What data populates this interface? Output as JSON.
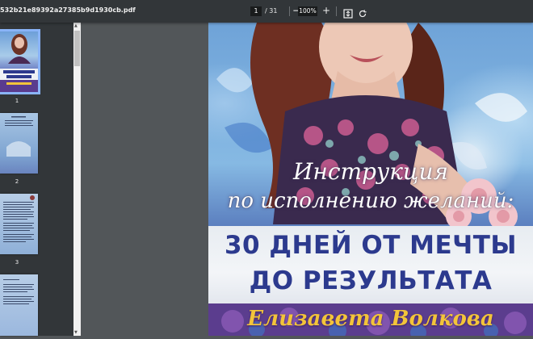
{
  "toolbar": {
    "filename": "532b21e89392a27385b9d1930cb.pdf",
    "current_page": "1",
    "page_separator": "/ 31",
    "zoom": "100%",
    "zoom_out_label": "−",
    "zoom_in_label": "+",
    "fit_icon": "fit-to-page-icon",
    "rotate_icon": "rotate-icon"
  },
  "sidebar": {
    "thumbnails": [
      {
        "num": "1",
        "selected": true
      },
      {
        "num": "2",
        "selected": false
      },
      {
        "num": "3",
        "selected": false
      },
      {
        "num": "",
        "selected": false
      }
    ]
  },
  "cover": {
    "script_line1": "Инструкция",
    "script_line2": "по исполнению желаний:",
    "title_line1": "30 ДНЕЙ ОТ МЕЧТЫ",
    "title_line2": "ДО РЕЗУЛЬТАТА",
    "author": "Елизавета Волкова"
  },
  "colors": {
    "toolbar": "#323639",
    "viewer_bg": "#525659",
    "title_blue": "#2c3a8e",
    "author_gold": "#f3c43a",
    "selection": "#8ab4f8"
  }
}
